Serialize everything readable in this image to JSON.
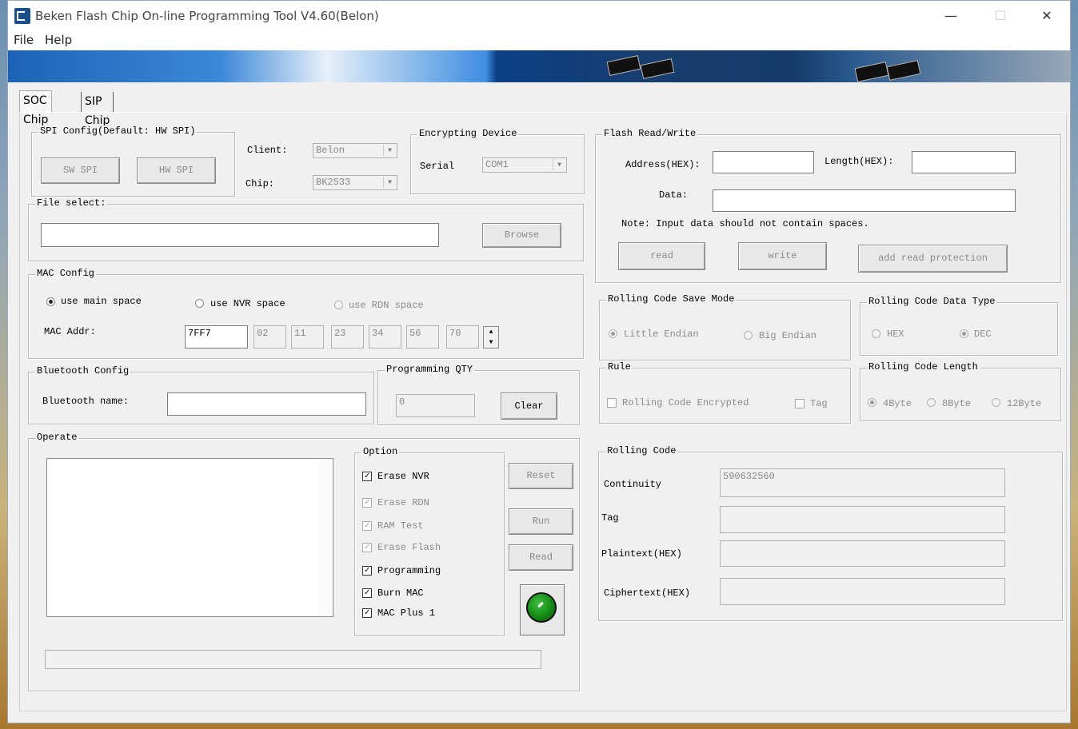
{
  "window": {
    "title": "Beken Flash Chip On-line Programming Tool V4.60(Belon)",
    "minimize": "—",
    "maximize": "☐",
    "close": "✕"
  },
  "menu": {
    "file": "File",
    "help": "Help"
  },
  "tabs": {
    "soc": "SOC Chip",
    "sip": "SIP Chip"
  },
  "spi_config": {
    "legend": "SPI Config(Default: HW SPI)",
    "sw_spi": "SW SPI",
    "hw_spi": "HW SPI"
  },
  "client": {
    "label": "Client:",
    "value": "Belon"
  },
  "chip": {
    "label": "Chip:",
    "value": "BK2533"
  },
  "encrypting_device": {
    "legend": "Encrypting Device",
    "serial_label": "Serial",
    "serial_value": "COM1"
  },
  "file_select": {
    "legend": "File select:",
    "path": "",
    "browse": "Browse"
  },
  "mac_config": {
    "legend": "MAC Config",
    "use_main_space": "use main space",
    "use_nvr_space": "use NVR space",
    "use_rdn_space": "use RDN space",
    "selected": "use main space",
    "mac_addr_label": "MAC Addr:",
    "mac_parts": [
      "7FF7",
      "02",
      "11",
      "23",
      "34",
      "56",
      "70"
    ]
  },
  "bluetooth_config": {
    "legend": "Bluetooth Config",
    "name_label": "Bluetooth name:",
    "name_value": ""
  },
  "programming_qty": {
    "legend": "Programming QTY",
    "value": "0",
    "clear": "Clear"
  },
  "operate": {
    "legend": "Operate"
  },
  "option": {
    "legend": "Option",
    "items": [
      {
        "label": "Erase NVR",
        "checked": true,
        "enabled": true
      },
      {
        "label": "Erase RDN",
        "checked": true,
        "enabled": false
      },
      {
        "label": "RAM Test",
        "checked": true,
        "enabled": false
      },
      {
        "label": "Erase Flash",
        "checked": true,
        "enabled": false
      },
      {
        "label": "Programming",
        "checked": true,
        "enabled": true
      },
      {
        "label": "Burn MAC",
        "checked": true,
        "enabled": true
      },
      {
        "label": "MAC Plus 1",
        "checked": true,
        "enabled": true
      }
    ],
    "check_mark": "✓"
  },
  "actions": {
    "reset": "Reset",
    "run": "Run",
    "read": "Read",
    "status_color": "#138a13"
  },
  "flash_rw": {
    "legend": "Flash Read/Write",
    "address_label": "Address(HEX):",
    "length_label": "Length(HEX):",
    "data_label": "Data:",
    "note": "Note: Input data should not contain spaces.",
    "read": "read",
    "write": "write",
    "add_read_protection": "add read protection"
  },
  "rolling_save_mode": {
    "legend": "Rolling Code Save Mode",
    "little_endian": "Little Endian",
    "big_endian": "Big Endian",
    "selected": "Little Endian"
  },
  "rolling_data_type": {
    "legend": "Rolling Code Data Type",
    "hex": "HEX",
    "dec": "DEC",
    "selected": "DEC"
  },
  "rule": {
    "legend": "Rule",
    "encrypted": "Rolling Code Encrypted",
    "tag": "Tag"
  },
  "rolling_length": {
    "legend": "Rolling Code Length",
    "b4": "4Byte",
    "b8": "8Byte",
    "b12": "12Byte",
    "selected": "4Byte"
  },
  "rolling_code": {
    "legend": "Rolling Code",
    "continuity_label": "Continuity",
    "continuity_value": "590632560",
    "tag_label": "Tag",
    "plaintext_label": "Plaintext(HEX)",
    "ciphertext_label": "Ciphertext(HEX)"
  },
  "spin": {
    "up": "▲",
    "down": "▼"
  },
  "combo_arrow": "▼"
}
